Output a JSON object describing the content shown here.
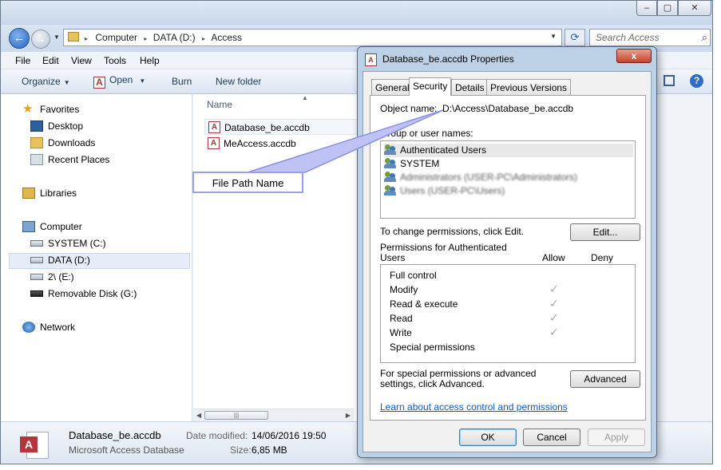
{
  "explorer": {
    "address": {
      "crumbs": [
        "Computer",
        "DATA (D:)",
        "Access"
      ],
      "separator": "▸"
    },
    "search_placeholder": "Search Access",
    "menu": [
      "File",
      "Edit",
      "View",
      "Tools",
      "Help"
    ],
    "toolbar": {
      "organize": "Organize",
      "open": "Open",
      "burn": "Burn",
      "new_folder": "New folder"
    },
    "sidebar": {
      "favorites": "Favorites",
      "desktop": "Desktop",
      "downloads": "Downloads",
      "recent": "Recent Places",
      "libraries": "Libraries",
      "computer": "Computer",
      "system": "SYSTEM (C:)",
      "data": "DATA (D:)",
      "e_drive": "2\\ (E:)",
      "removable": "Removable Disk (G:)",
      "network": "Network"
    },
    "column_name": "Name",
    "files": [
      "Database_be.accdb",
      "MeAccess.accdb"
    ],
    "details": {
      "name": "Database_be.accdb",
      "type": "Microsoft Access Database",
      "modified_label": "Date modified:",
      "modified_value": "14/06/2016 19:50",
      "size_label": "Size:",
      "size_value": "6,85 MB"
    }
  },
  "annotation": {
    "text": "File Path Name"
  },
  "dialog": {
    "title": "Database_be.accdb Properties",
    "tabs": [
      "General",
      "Security",
      "Details",
      "Previous Versions"
    ],
    "active_tab": "Security",
    "object_name_label": "Object name:",
    "object_name_value": "D:\\Access\\Database_be.accdb",
    "group_label": "Group or user names:",
    "groups": [
      "Authenticated Users",
      "SYSTEM",
      "Administrators (USER-PC\\Administrators)",
      "Users (USER-PC\\Users)"
    ],
    "change_text": "To change permissions, click Edit.",
    "edit_button": "Edit...",
    "permissions_for": "Permissions for Authenticated Users",
    "allow": "Allow",
    "deny": "Deny",
    "permissions": [
      {
        "name": "Full control",
        "allow": ""
      },
      {
        "name": "Modify",
        "allow": "✓"
      },
      {
        "name": "Read & execute",
        "allow": "✓"
      },
      {
        "name": "Read",
        "allow": "✓"
      },
      {
        "name": "Write",
        "allow": "✓"
      },
      {
        "name": "Special permissions",
        "allow": ""
      }
    ],
    "special_text": "For special permissions or advanced settings, click Advanced.",
    "advanced_button": "Advanced",
    "learn_link": "Learn about access control and permissions",
    "ok": "OK",
    "cancel": "Cancel",
    "apply": "Apply",
    "close_glyph": "x"
  },
  "colors": {
    "accent": "#2f6cc4",
    "annotation_border": "#9b9fe8",
    "link": "#0b5bc9"
  }
}
